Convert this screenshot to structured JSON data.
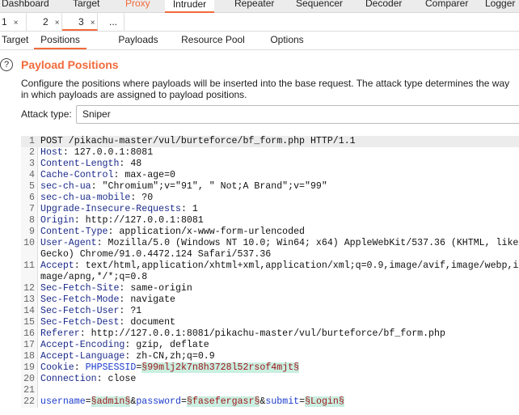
{
  "top_tabs": [
    "Dashboard",
    "Target",
    "Proxy",
    "Intruder",
    "Repeater",
    "Sequencer",
    "Decoder",
    "Comparer",
    "Logger"
  ],
  "attack_tabs": [
    "1",
    "2",
    "3",
    "..."
  ],
  "sub_tabs": [
    "Target",
    "Positions",
    "Payloads",
    "Resource Pool",
    "Options"
  ],
  "help_icon": "?",
  "section_title": "Payload Positions",
  "description": "Configure the positions where payloads will be inserted into the base request. The attack type determines the way in which payloads are assigned to payload positions.",
  "attack_type_label": "Attack type:",
  "attack_type_value": "Sniper",
  "colors": {
    "accent": "#f26a3b",
    "payload_bg": "#c9efe1",
    "payload_text": "#a0161a"
  },
  "request_lines": [
    [
      [
        "val",
        "POST /pikachu-master/vul/burteforce/bf_form.php HTTP/1.1"
      ]
    ],
    [
      [
        "name",
        "Host"
      ],
      [
        "val",
        ": 127.0.0.1:8081"
      ]
    ],
    [
      [
        "name",
        "Content-Length"
      ],
      [
        "val",
        ": 48"
      ]
    ],
    [
      [
        "name",
        "Cache-Control"
      ],
      [
        "val",
        ": max-age=0"
      ]
    ],
    [
      [
        "name",
        "sec-ch-ua"
      ],
      [
        "val",
        ": \"Chromium\";v=\"91\", \" Not;A Brand\";v=\"99\""
      ]
    ],
    [
      [
        "name",
        "sec-ch-ua-mobile"
      ],
      [
        "val",
        ": ?0"
      ]
    ],
    [
      [
        "name",
        "Upgrade-Insecure-Requests"
      ],
      [
        "val",
        ": 1"
      ]
    ],
    [
      [
        "name",
        "Origin"
      ],
      [
        "val",
        ": http://127.0.0.1:8081"
      ]
    ],
    [
      [
        "name",
        "Content-Type"
      ],
      [
        "val",
        ": application/x-www-form-urlencoded"
      ]
    ],
    [
      [
        "name",
        "User-Agent"
      ],
      [
        "val",
        ": Mozilla/5.0 (Windows NT 10.0; Win64; x64) AppleWebKit/537.36 (KHTML, like Gecko) Chrome/91.0.4472.124 Safari/537.36"
      ]
    ],
    [
      [
        "name",
        "Accept"
      ],
      [
        "val",
        ": text/html,application/xhtml+xml,application/xml;q=0.9,image/avif,image/webp,image/apng,*/*;q=0.8"
      ]
    ],
    [
      [
        "name",
        "Sec-Fetch-Site"
      ],
      [
        "val",
        ": same-origin"
      ]
    ],
    [
      [
        "name",
        "Sec-Fetch-Mode"
      ],
      [
        "val",
        ": navigate"
      ]
    ],
    [
      [
        "name",
        "Sec-Fetch-User"
      ],
      [
        "val",
        ": ?1"
      ]
    ],
    [
      [
        "name",
        "Sec-Fetch-Dest"
      ],
      [
        "val",
        ": document"
      ]
    ],
    [
      [
        "name",
        "Referer"
      ],
      [
        "val",
        ": http://127.0.0.1:8081/pikachu-master/vul/burteforce/bf_form.php"
      ]
    ],
    [
      [
        "name",
        "Accept-Encoding"
      ],
      [
        "val",
        ": gzip, deflate"
      ]
    ],
    [
      [
        "name",
        "Accept-Language"
      ],
      [
        "val",
        ": zh-CN,zh;q=0.9"
      ]
    ],
    [
      [
        "name",
        "Cookie"
      ],
      [
        "val",
        ": "
      ],
      [
        "param",
        "PHPSESSID"
      ],
      [
        "val",
        "="
      ],
      [
        "pl",
        "§99mlj2k7n8h3728l52rsof4mjt§"
      ]
    ],
    [
      [
        "name",
        "Connection"
      ],
      [
        "val",
        ": close"
      ]
    ],
    [],
    [
      [
        "param",
        "username"
      ],
      [
        "val",
        "="
      ],
      [
        "pl",
        "§admin§"
      ],
      [
        "val",
        "&"
      ],
      [
        "param",
        "password"
      ],
      [
        "val",
        "="
      ],
      [
        "pl",
        "§fasefergasr§"
      ],
      [
        "val",
        "&"
      ],
      [
        "param",
        "submit"
      ],
      [
        "val",
        "="
      ],
      [
        "pl",
        "§Login§"
      ]
    ]
  ]
}
